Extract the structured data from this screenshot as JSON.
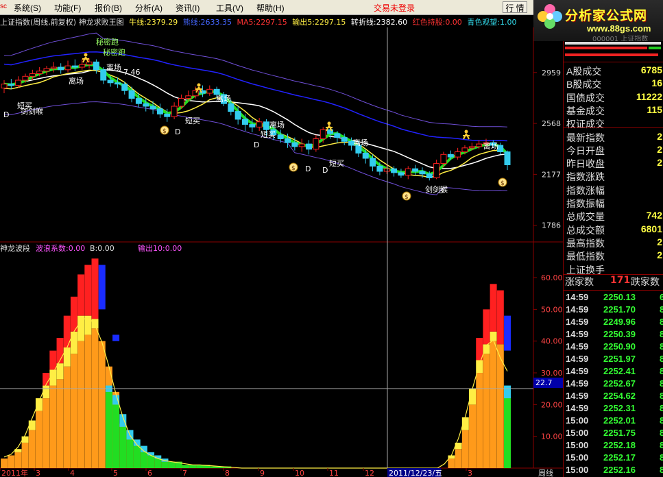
{
  "menu": {
    "stub": "sc",
    "items": [
      "系统(S)",
      "功能(F)",
      "报价(B)",
      "分析(A)",
      "资讯(I)",
      "工具(V)",
      "帮助(H)"
    ],
    "trade_status": "交易未登录",
    "row_button": "行 情"
  },
  "watermark": {
    "title": "分析家公式网",
    "url": "www.88gs.com",
    "faded": "000001 上证指数"
  },
  "header": {
    "title": "上证指数(周线,前复权) 神龙求败王图",
    "niu": "牛线:2379.29",
    "xiong": "熊线:2633.35",
    "ma5": "MA5:2297.15",
    "out5": "输出5:2297.15",
    "turn": "转折线:2382.60",
    "red": "红色持股:0.00",
    "cyan": "青色观望:1.00"
  },
  "subheader": {
    "name": "神龙波段",
    "wave": "波浪系数:0.00",
    "b": "B:0.00",
    "out10": "输出10:0.00"
  },
  "colors": {
    "up": "#ff2020",
    "down": "#33ccee",
    "yellow_band": "#ffee44",
    "white_line": "#ffffff",
    "green_line": "#22dd22",
    "blue_line": "#2222ff",
    "purple_band": "#6f4fd8",
    "axis_red": "#8b0000",
    "orange": "#ff9a1a"
  },
  "chart_data": [
    {
      "type": "candlestick",
      "title": "上证指数(周线,前复权)",
      "price_axis": [
        "2959",
        "2568",
        "2177",
        "1786"
      ],
      "ylim": [
        1700,
        3200
      ],
      "annotations": [
        "秘密跑",
        "秘密跑",
        "离场",
        "离场",
        "离场",
        "离场",
        "离场",
        "离场",
        "短买",
        "短买",
        "短买",
        "短买",
        "D",
        "D",
        "D",
        "D",
        "D",
        "剑剑喉",
        "剑剑喉",
        "7.46",
        "3"
      ],
      "candles": [
        {
          "o": 2840,
          "c": 2870,
          "h": 2900,
          "l": 2800
        },
        {
          "o": 2870,
          "c": 2860,
          "h": 2910,
          "l": 2830
        },
        {
          "o": 2860,
          "c": 2900,
          "h": 2930,
          "l": 2840
        },
        {
          "o": 2900,
          "c": 2930,
          "h": 2950,
          "l": 2880
        },
        {
          "o": 2930,
          "c": 2950,
          "h": 2980,
          "l": 2900
        },
        {
          "o": 2950,
          "c": 2970,
          "h": 3000,
          "l": 2930
        },
        {
          "o": 2970,
          "c": 2990,
          "h": 3010,
          "l": 2940
        },
        {
          "o": 2990,
          "c": 3000,
          "h": 3040,
          "l": 2960
        },
        {
          "o": 3000,
          "c": 2980,
          "h": 3030,
          "l": 2950
        },
        {
          "o": 2980,
          "c": 3010,
          "h": 3050,
          "l": 2960
        },
        {
          "o": 3010,
          "c": 3000,
          "h": 3060,
          "l": 2970
        },
        {
          "o": 3000,
          "c": 3020,
          "h": 3060,
          "l": 2980
        },
        {
          "o": 3020,
          "c": 3040,
          "h": 3067,
          "l": 2990
        },
        {
          "o": 3040,
          "c": 2980,
          "h": 3060,
          "l": 2950
        },
        {
          "o": 2980,
          "c": 2900,
          "h": 3000,
          "l": 2870
        },
        {
          "o": 2900,
          "c": 2880,
          "h": 2930,
          "l": 2850
        },
        {
          "o": 2880,
          "c": 2870,
          "h": 2920,
          "l": 2840
        },
        {
          "o": 2870,
          "c": 2820,
          "h": 2890,
          "l": 2790
        },
        {
          "o": 2820,
          "c": 2760,
          "h": 2850,
          "l": 2730
        },
        {
          "o": 2760,
          "c": 2720,
          "h": 2800,
          "l": 2690
        },
        {
          "o": 2720,
          "c": 2700,
          "h": 2760,
          "l": 2660
        },
        {
          "o": 2700,
          "c": 2680,
          "h": 2740,
          "l": 2640
        },
        {
          "o": 2680,
          "c": 2640,
          "h": 2720,
          "l": 2610
        },
        {
          "o": 2640,
          "c": 2620,
          "h": 2680,
          "l": 2580
        },
        {
          "o": 2620,
          "c": 2700,
          "h": 2730,
          "l": 2600
        },
        {
          "o": 2700,
          "c": 2760,
          "h": 2790,
          "l": 2680
        },
        {
          "o": 2760,
          "c": 2780,
          "h": 2820,
          "l": 2740
        },
        {
          "o": 2780,
          "c": 2820,
          "h": 2850,
          "l": 2760
        },
        {
          "o": 2820,
          "c": 2800,
          "h": 2860,
          "l": 2770
        },
        {
          "o": 2800,
          "c": 2830,
          "h": 2860,
          "l": 2780
        },
        {
          "o": 2830,
          "c": 2790,
          "h": 2850,
          "l": 2760
        },
        {
          "o": 2790,
          "c": 2720,
          "h": 2810,
          "l": 2700
        },
        {
          "o": 2720,
          "c": 2660,
          "h": 2750,
          "l": 2630
        },
        {
          "o": 2660,
          "c": 2600,
          "h": 2700,
          "l": 2560
        },
        {
          "o": 2600,
          "c": 2560,
          "h": 2640,
          "l": 2510
        },
        {
          "o": 2560,
          "c": 2540,
          "h": 2600,
          "l": 2500
        },
        {
          "o": 2540,
          "c": 2580,
          "h": 2610,
          "l": 2510
        },
        {
          "o": 2580,
          "c": 2520,
          "h": 2600,
          "l": 2470
        },
        {
          "o": 2520,
          "c": 2480,
          "h": 2560,
          "l": 2440
        },
        {
          "o": 2480,
          "c": 2450,
          "h": 2520,
          "l": 2420
        },
        {
          "o": 2450,
          "c": 2420,
          "h": 2490,
          "l": 2380
        },
        {
          "o": 2420,
          "c": 2390,
          "h": 2460,
          "l": 2360
        },
        {
          "o": 2390,
          "c": 2410,
          "h": 2450,
          "l": 2350
        },
        {
          "o": 2410,
          "c": 2370,
          "h": 2440,
          "l": 2330
        },
        {
          "o": 2370,
          "c": 2450,
          "h": 2480,
          "l": 2350
        },
        {
          "o": 2450,
          "c": 2520,
          "h": 2540,
          "l": 2420
        },
        {
          "o": 2520,
          "c": 2490,
          "h": 2540,
          "l": 2450
        },
        {
          "o": 2490,
          "c": 2460,
          "h": 2510,
          "l": 2420
        },
        {
          "o": 2460,
          "c": 2430,
          "h": 2490,
          "l": 2400
        },
        {
          "o": 2430,
          "c": 2400,
          "h": 2460,
          "l": 2360
        },
        {
          "o": 2400,
          "c": 2340,
          "h": 2430,
          "l": 2310
        },
        {
          "o": 2340,
          "c": 2300,
          "h": 2370,
          "l": 2260
        },
        {
          "o": 2300,
          "c": 2240,
          "h": 2330,
          "l": 2200
        },
        {
          "o": 2240,
          "c": 2200,
          "h": 2270,
          "l": 2170
        },
        {
          "o": 2200,
          "c": 2220,
          "h": 2250,
          "l": 2180
        },
        {
          "o": 2220,
          "c": 2190,
          "h": 2240,
          "l": 2160
        },
        {
          "o": 2190,
          "c": 2170,
          "h": 2220,
          "l": 2150
        },
        {
          "o": 2170,
          "c": 2220,
          "h": 2240,
          "l": 2140
        },
        {
          "o": 2220,
          "c": 2200,
          "h": 2250,
          "l": 2170
        },
        {
          "o": 2200,
          "c": 2180,
          "h": 2230,
          "l": 2150
        },
        {
          "o": 2180,
          "c": 2150,
          "h": 2200,
          "l": 2130
        },
        {
          "o": 2150,
          "c": 2260,
          "h": 2290,
          "l": 2140
        },
        {
          "o": 2260,
          "c": 2330,
          "h": 2350,
          "l": 2230
        },
        {
          "o": 2330,
          "c": 2310,
          "h": 2360,
          "l": 2290
        },
        {
          "o": 2310,
          "c": 2350,
          "h": 2380,
          "l": 2290
        },
        {
          "o": 2350,
          "c": 2380,
          "h": 2400,
          "l": 2330
        },
        {
          "o": 2380,
          "c": 2390,
          "h": 2420,
          "l": 2360
        },
        {
          "o": 2390,
          "c": 2410,
          "h": 2440,
          "l": 2370
        },
        {
          "o": 2410,
          "c": 2420,
          "h": 2450,
          "l": 2390
        },
        {
          "o": 2420,
          "c": 2400,
          "h": 2440,
          "l": 2380
        },
        {
          "o": 2400,
          "c": 2350,
          "h": 2420,
          "l": 2330
        },
        {
          "o": 2350,
          "c": 2250,
          "h": 2360,
          "l": 2210
        }
      ]
    },
    {
      "type": "bar",
      "title": "神龙波段",
      "y_axis": [
        "60.00",
        "50.00",
        "40.00",
        "30.00",
        "20.00",
        "10.00"
      ],
      "ylim": [
        0,
        68
      ],
      "cursor_value": "22.7",
      "orange": [
        3,
        4,
        5,
        8,
        12,
        18,
        22,
        26,
        28,
        32,
        36,
        40,
        42,
        44,
        40,
        32,
        24,
        14,
        10,
        7,
        5,
        4,
        3,
        2,
        2,
        2,
        1,
        1,
        1,
        1,
        0.5,
        0.5,
        0.5,
        0,
        0,
        0,
        0,
        0,
        0,
        0,
        0,
        0,
        0,
        0,
        0,
        0,
        0,
        0,
        0,
        0,
        0,
        0,
        0,
        0,
        0,
        0,
        0,
        0,
        0,
        0,
        0,
        0,
        0,
        0,
        3,
        6,
        12,
        20,
        30,
        36,
        40,
        39,
        22
      ],
      "yellow": [
        0,
        0,
        1,
        2,
        3,
        4,
        4,
        5,
        5,
        6,
        7,
        8,
        6,
        3,
        0,
        0,
        0,
        0,
        0,
        0,
        0,
        0,
        0,
        0,
        0,
        0,
        0,
        0,
        0,
        0,
        0,
        0,
        0,
        0,
        0,
        0,
        0,
        0,
        0,
        0,
        0,
        0,
        0,
        0,
        0,
        0,
        0,
        0,
        0,
        0,
        0,
        0,
        0,
        0,
        0,
        0,
        0,
        0,
        0,
        0,
        0,
        0,
        0,
        0,
        1,
        2,
        4,
        5,
        4,
        3,
        3,
        0,
        0
      ],
      "red": [
        0,
        0,
        0,
        0,
        0,
        0,
        4,
        6,
        8,
        10,
        11,
        13,
        16,
        19,
        0,
        0,
        0,
        0,
        0,
        0,
        0,
        0,
        0,
        0,
        0,
        0,
        0,
        0,
        0,
        0,
        0,
        0,
        0,
        0,
        0,
        0,
        0,
        0,
        0,
        0,
        0,
        0,
        0,
        0,
        0,
        0,
        0,
        0,
        0,
        0,
        0,
        0,
        0,
        0,
        0,
        0,
        0,
        0,
        0,
        0,
        0,
        0,
        0,
        0,
        0,
        0,
        0,
        0,
        7,
        11,
        15,
        17,
        0
      ],
      "blue": [
        0,
        0,
        0,
        0,
        0,
        0,
        0,
        0,
        0,
        0,
        0,
        0,
        0,
        0,
        14,
        0,
        2,
        0,
        0,
        0,
        0,
        0,
        0,
        0,
        0,
        0,
        0,
        0,
        0,
        0,
        0,
        0,
        0,
        0,
        0,
        0,
        0,
        0,
        0,
        0,
        0,
        0,
        0,
        0,
        0,
        0,
        0,
        0,
        0,
        0,
        0,
        0,
        0,
        0,
        0,
        0,
        0,
        0,
        0,
        0,
        0,
        0,
        0,
        0,
        0,
        0,
        0,
        0,
        0,
        0,
        0,
        0,
        11
      ],
      "green": [
        0,
        0,
        0,
        0,
        0,
        0,
        0,
        0,
        0,
        0,
        0,
        0,
        0,
        0,
        0,
        24,
        20,
        13,
        9,
        7,
        5,
        4,
        3,
        2,
        2,
        2,
        1,
        1,
        1,
        1,
        0.5,
        0.5,
        0.5,
        0,
        0,
        0,
        0,
        0,
        0,
        0,
        0,
        0,
        0,
        0,
        0,
        0,
        0,
        0,
        0,
        0,
        0,
        0,
        0,
        0,
        0,
        0,
        0,
        0,
        0,
        0,
        0,
        0,
        0,
        0,
        0,
        0,
        0,
        0,
        0,
        0,
        0,
        0,
        22
      ],
      "cyan": [
        0,
        0,
        0,
        0,
        0,
        0,
        0,
        0,
        0,
        0,
        0,
        0,
        0,
        0,
        0,
        2,
        3,
        4,
        3,
        2,
        2,
        1,
        1,
        1,
        0,
        0,
        0,
        0,
        0,
        0,
        0,
        0,
        0,
        0,
        0,
        0,
        0,
        0,
        0,
        0,
        0,
        0,
        0,
        0,
        0,
        0,
        0,
        0,
        0,
        0,
        0,
        0,
        0,
        0,
        0,
        0,
        0,
        0,
        0,
        0,
        0,
        0,
        0,
        0,
        0,
        0,
        0,
        0,
        0,
        0,
        2,
        0,
        4
      ]
    }
  ],
  "date_axis": [
    "2011年",
    "3",
    "4",
    "5",
    "6",
    "7",
    "8",
    "9",
    "10",
    "11",
    "12",
    "2011/12/23/五",
    "3"
  ],
  "period": "周线",
  "stats": [
    {
      "label": "A股成交",
      "value": "6785"
    },
    {
      "label": "B股成交",
      "value": "16"
    },
    {
      "label": "国债成交",
      "value": "11222"
    },
    {
      "label": "基金成交",
      "value": "115"
    },
    {
      "label": "权证成交",
      "value": ""
    },
    {
      "label": "最新指数",
      "value": "2"
    },
    {
      "label": "今日开盘",
      "value": "2"
    },
    {
      "label": "昨日收盘",
      "value": "2"
    },
    {
      "label": "指数涨跌",
      "value": ""
    },
    {
      "label": "指数涨幅",
      "value": ""
    },
    {
      "label": "指数振幅",
      "value": ""
    },
    {
      "label": "总成交量",
      "value": "742"
    },
    {
      "label": "总成交额",
      "value": "6801"
    },
    {
      "label": "最高指数",
      "value": "2"
    },
    {
      "label": "最低指数",
      "value": "2"
    },
    {
      "label": "上证换手",
      "value": ""
    }
  ],
  "updown": {
    "up_label": "涨家数",
    "up_value": "171",
    "down_label": "跌家数"
  },
  "ticks": [
    {
      "time": "14:59",
      "price": "2250.13"
    },
    {
      "time": "14:59",
      "price": "2251.70"
    },
    {
      "time": "14:59",
      "price": "2249.96"
    },
    {
      "time": "14:59",
      "price": "2250.39"
    },
    {
      "time": "14:59",
      "price": "2250.90"
    },
    {
      "time": "14:59",
      "price": "2251.97"
    },
    {
      "time": "14:59",
      "price": "2252.41"
    },
    {
      "time": "14:59",
      "price": "2252.67"
    },
    {
      "time": "14:59",
      "price": "2254.62"
    },
    {
      "time": "14:59",
      "price": "2252.31"
    },
    {
      "time": "15:00",
      "price": "2252.01"
    },
    {
      "time": "15:00",
      "price": "2251.75"
    },
    {
      "time": "15:00",
      "price": "2252.18"
    },
    {
      "time": "15:00",
      "price": "2252.17"
    },
    {
      "time": "15:00",
      "price": "2252.16"
    }
  ],
  "tick_extra": [
    "6",
    "8",
    "8",
    "8",
    "8",
    "8",
    "8",
    "8",
    "8",
    "8",
    "8",
    "8",
    "8",
    "8",
    "8"
  ]
}
